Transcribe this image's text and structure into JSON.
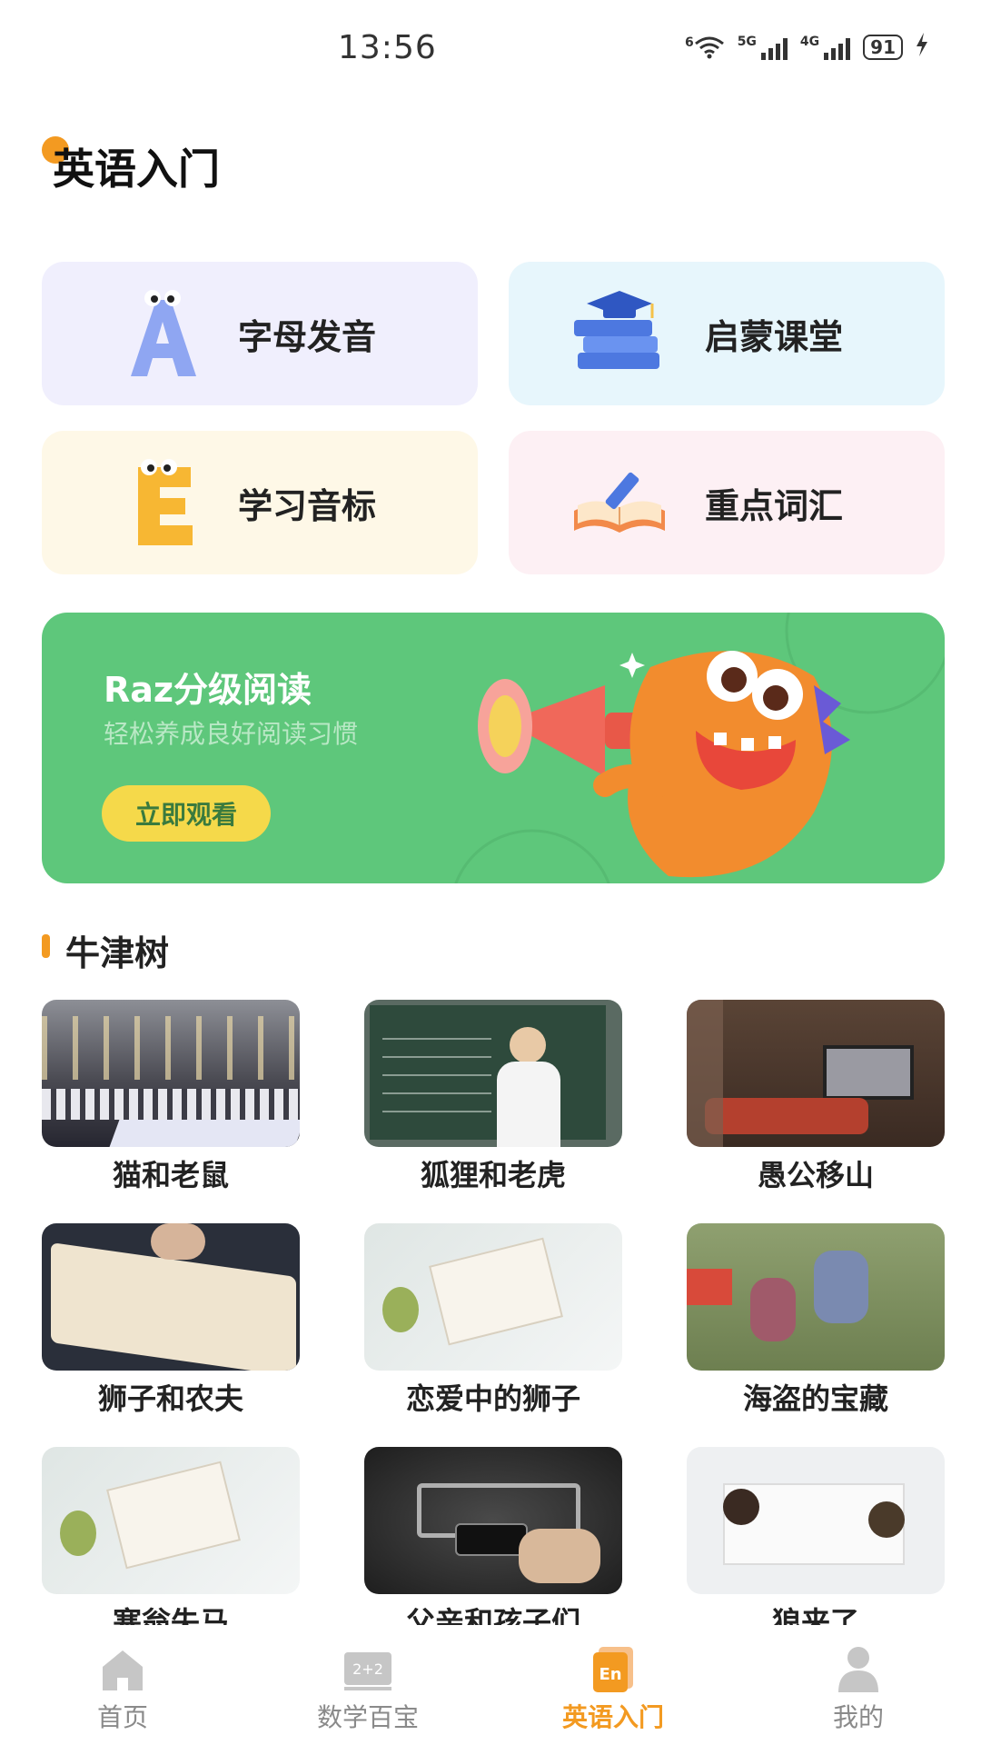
{
  "status_bar": {
    "time": "13:56",
    "wifi_label": "6",
    "signal_1_label": "5G",
    "signal_2_label": "4G",
    "battery": "91"
  },
  "page": {
    "title": "英语入门"
  },
  "tiles": [
    {
      "label": "字母发音",
      "icon": "letter-a-icon"
    },
    {
      "label": "启蒙课堂",
      "icon": "graduation-books-icon"
    },
    {
      "label": "学习音标",
      "icon": "letter-e-icon"
    },
    {
      "label": "重点词汇",
      "icon": "open-book-pencil-icon"
    }
  ],
  "banner": {
    "title": "Raz分级阅读",
    "subtitle": "轻松养成良好阅读习惯",
    "button": "立即观看"
  },
  "section": {
    "title": "牛津树"
  },
  "stories": [
    {
      "title": "猫和老鼠"
    },
    {
      "title": "狐狸和老虎"
    },
    {
      "title": "愚公移山"
    },
    {
      "title": "狮子和农夫"
    },
    {
      "title": "恋爱中的狮子"
    },
    {
      "title": "海盗的宝藏"
    },
    {
      "title": "塞翁失马"
    },
    {
      "title": "父亲和孩子们"
    },
    {
      "title": "狼来了"
    }
  ],
  "bottom_nav": [
    {
      "label": "首页",
      "icon": "home-icon",
      "active": false
    },
    {
      "label": "数学百宝",
      "icon": "math-board-icon",
      "active": false
    },
    {
      "label": "英语入门",
      "icon": "english-book-icon",
      "active": true
    },
    {
      "label": "我的",
      "icon": "profile-icon",
      "active": false
    }
  ],
  "colors": {
    "accent": "#f39a21",
    "banner": "#5ec77b",
    "banner_button": "#f5d94a"
  }
}
